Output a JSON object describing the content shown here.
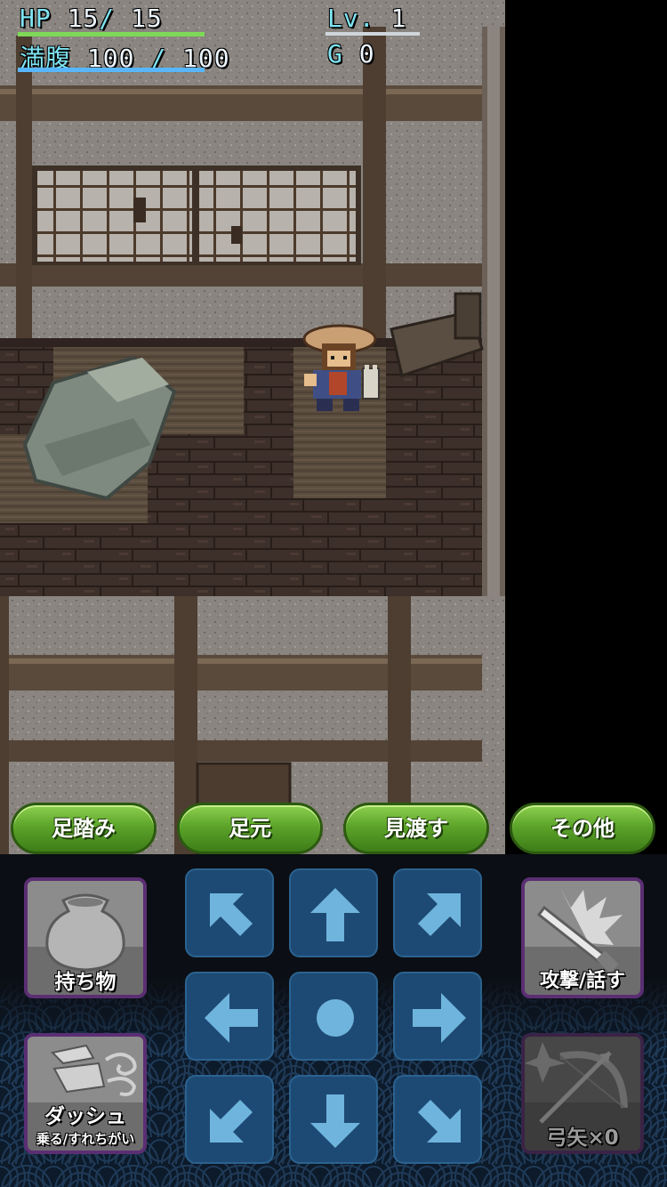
{
  "hud": {
    "hp_label": "HP",
    "hp_current": "15",
    "hp_max": "15",
    "hp_fraction": 1.0,
    "hunger_label": "満腹",
    "hunger_current": "100",
    "hunger_max": "100",
    "hunger_fraction": 1.0,
    "level_label": "Lv.",
    "level": "1",
    "gold_label": "G",
    "gold": "0"
  },
  "command_buttons": {
    "step": "足踏み",
    "underfoot": "足元",
    "look_around": "見渡す",
    "other": "その他"
  },
  "actions": {
    "inventory_label": "持ち物",
    "attack_label": "攻撃/話す",
    "dash_label": "ダッシュ",
    "dash_sublabel": "乗る/すれちがい",
    "arrows_label": "弓矢×0"
  },
  "colors": {
    "hp_bar": "#7ed957",
    "hunger_bar": "#58b6ff",
    "command_button": "#5ca42a",
    "dpad_button": "#1d4a74",
    "dpad_arrow": "#6fb4dc",
    "action_border": "#5b2e73"
  }
}
